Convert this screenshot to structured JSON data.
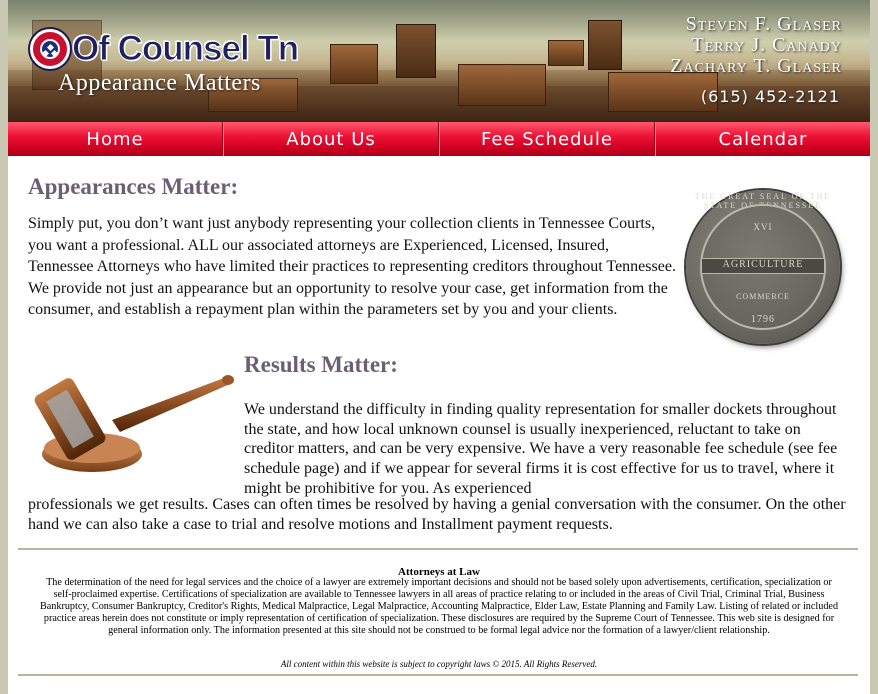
{
  "header": {
    "logo_text": "Of Counsel Tn",
    "tagline": "Appearance Matters",
    "attorneys": [
      "Steven F. Glaser",
      "Terry J. Canady",
      "Zachary T. Glaser"
    ],
    "phone": "(615) 452-2121"
  },
  "nav": {
    "items": [
      {
        "label": "Home"
      },
      {
        "label": "About Us"
      },
      {
        "label": "Fee Schedule"
      },
      {
        "label": "Calendar"
      }
    ]
  },
  "section1": {
    "heading": "Appearances Matter:",
    "body": "Simply put, you don’t want just anybody representing your collection clients in Tennessee Courts, you want a professional. ALL our associated attorneys are Experienced, Licensed, Insured, Tennessee Attorneys who have limited their practices to representing creditors throughout Tennessee. We provide not just an appearance but an opportunity to resolve your case, get information from the consumer, and establish a repayment plan within the parameters set by you and your clients."
  },
  "seal": {
    "arc_text": "THE GREAT SEAL OF THE STATE OF TENNESSEE",
    "numeral": "XVI",
    "band": "AGRICULTURE",
    "lower": "COMMERCE",
    "year": "1796"
  },
  "section2": {
    "heading": "Results Matter:",
    "body_part1": "We understand the difficulty in finding quality representation for smaller dockets throughout the state, and how local unknown counsel is usually inexperienced, reluctant to take on creditor matters, and can be very expensive. We have a very reasonable fee schedule (see fee schedule page) and if we appear for several firms it is cost effective for us to travel, where it might be prohibitive for you. As experienced",
    "body_part2": "professionals we get results. Cases can often times be resolved by having a genial conversation with the consumer. On the other hand we can also take a case to trial and resolve motions and Installment payment requests."
  },
  "footer": {
    "title": "Attorneys at Law",
    "disclaimer": "The determination of the need for legal services and the choice of a lawyer are extremely important decisions and should not be based solely upon advertisements, certification, specialization or self-proclaimed expertise. Certifications of specialization are available to Tennessee lawyers in all areas of practice relating to or included in the areas of Civil Trial, Criminal Trial, Business Bankruptcy, Consumer Bankruptcy, Creditor's Rights, Medical Malpractice, Legal Malpractice, Accounting Malpractice, Elder Law, Estate Planning and Family Law. Listing of related or included practice areas herein does not constitute or imply representation of certification of specialization. These disclosures are required by the Supreme Court of Tennessee. This web site is designed for general information only. The information presented at this site should not be construed to be formal legal advice nor the formation of a lawyer/client relationship.",
    "copyright": "All content within this website is subject to copyright laws © 2015. All Rights Reserved."
  },
  "colors": {
    "nav_red": "#e8102e",
    "heading_purple": "#6b5f75",
    "logo_navy": "#1e2060",
    "page_bg": "#c9c8b2"
  }
}
